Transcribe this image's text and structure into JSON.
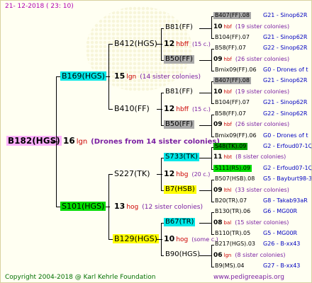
{
  "timestamp": "21- 12-2018 (  23: 10)",
  "footer": {
    "copyright": "Copyright 2004-2018 @ Karl Kehrle Foundation",
    "site": "www.pedigreeapis.org"
  },
  "colors": {
    "root": "#ffb0ff",
    "cyan": "#00e8e8",
    "green": "#00dd00",
    "yellow": "#ffff00",
    "grey": "#aaaaaa",
    "dark_green": "#00a000",
    "blue": "#0000c0",
    "purple": "#7a1fa2",
    "red": "#cc0000"
  },
  "root": {
    "name": "B182(HGS)",
    "gen_num": "16",
    "gen_abbr": "lgn",
    "note": "(Drones from 14 sister colonies)"
  },
  "g1": [
    {
      "name": "B169(HGS)",
      "gen_num": "15",
      "gen_abbr": "lgn",
      "note": "(14 sister colonies)"
    },
    {
      "name": "S101(HGS)",
      "gen_num": "13",
      "gen_abbr": "hog",
      "note": "(12 sister colonies)"
    }
  ],
  "g2": [
    {
      "name": "B412(HGS)",
      "gen_num": "12",
      "gen_abbr": "hbff",
      "note": "(15 c.)"
    },
    {
      "name": "B410(FF)",
      "gen_num": "12",
      "gen_abbr": "hbff",
      "note": "(15 c.)"
    },
    {
      "name": "S227(TK)",
      "gen_num": "12",
      "gen_abbr": "hbg",
      "note": "(20 c.)"
    },
    {
      "name": "B129(HGS)",
      "gen_num": "10",
      "gen_abbr": "hog",
      "note": "(some c.)"
    }
  ],
  "g3": [
    "B81(FF)",
    "B50(FF)",
    "B81(FF)",
    "B50(FF)",
    "S733(TK)",
    "B7(HSB)",
    "B67(TR)",
    "B90(HGS)"
  ],
  "g4": [
    {
      "top": "B407(FF).08",
      "top_loc": "G21 - Sinop62R",
      "gen_num": "10",
      "gen_abbr": "hbf",
      "note": "(19 sister colonies)",
      "bottom": "B104(FF).07",
      "bottom_loc": "G21 - Sinop62R"
    },
    {
      "top": "B58(FF).07",
      "top_loc": "G22 - Sinop62R",
      "gen_num": "09",
      "gen_abbr": "hbf",
      "note": "(26 sister colonies)",
      "bottom": "Bmix09(FF).06",
      "bottom_loc": "G0 - Drones of t"
    },
    {
      "top": "B407(FF).08",
      "top_loc": "G21 - Sinop62R",
      "gen_num": "10",
      "gen_abbr": "hbf",
      "note": "(19 sister colonies)",
      "bottom": "B104(FF).07",
      "bottom_loc": "G21 - Sinop62R"
    },
    {
      "top": "B58(FF).07",
      "top_loc": "G22 - Sinop62R",
      "gen_num": "09",
      "gen_abbr": "hbf",
      "note": "(26 sister colonies)",
      "bottom": "Bmix09(FF).06",
      "bottom_loc": "G0 - Drones of t"
    },
    {
      "top": "S48(TK).09",
      "top_loc": "G2 - Erfoud07-1Q",
      "gen_num": "11",
      "gen_abbr": "hbt",
      "note": "(8 sister colonies)",
      "bottom": "S111(RS).09",
      "bottom_loc": "G2 - Erfoud07-1Q"
    },
    {
      "top": "B507(HSB).08",
      "top_loc": "G5 - Bayburt98-3",
      "gen_num": "09",
      "gen_abbr": "lthl",
      "note": "(33 sister colonies)",
      "bottom": "B20(TR).07",
      "bottom_loc": "G8 - Takab93aR"
    },
    {
      "top": "B130(TR).06",
      "top_loc": "G6 - MG00R",
      "gen_num": "08",
      "gen_abbr": "bal",
      "note": "(15 sister colonies)",
      "bottom": "B110(TR).05",
      "bottom_loc": "G5 - MG00R"
    },
    {
      "top": "B217(HGS).03",
      "top_loc": "G26 - B-xx43",
      "gen_num": "06",
      "gen_abbr": "lgn",
      "note": "(8 sister colonies)",
      "bottom": "B9(MS).04",
      "bottom_loc": "G27 - B-xx43"
    }
  ]
}
